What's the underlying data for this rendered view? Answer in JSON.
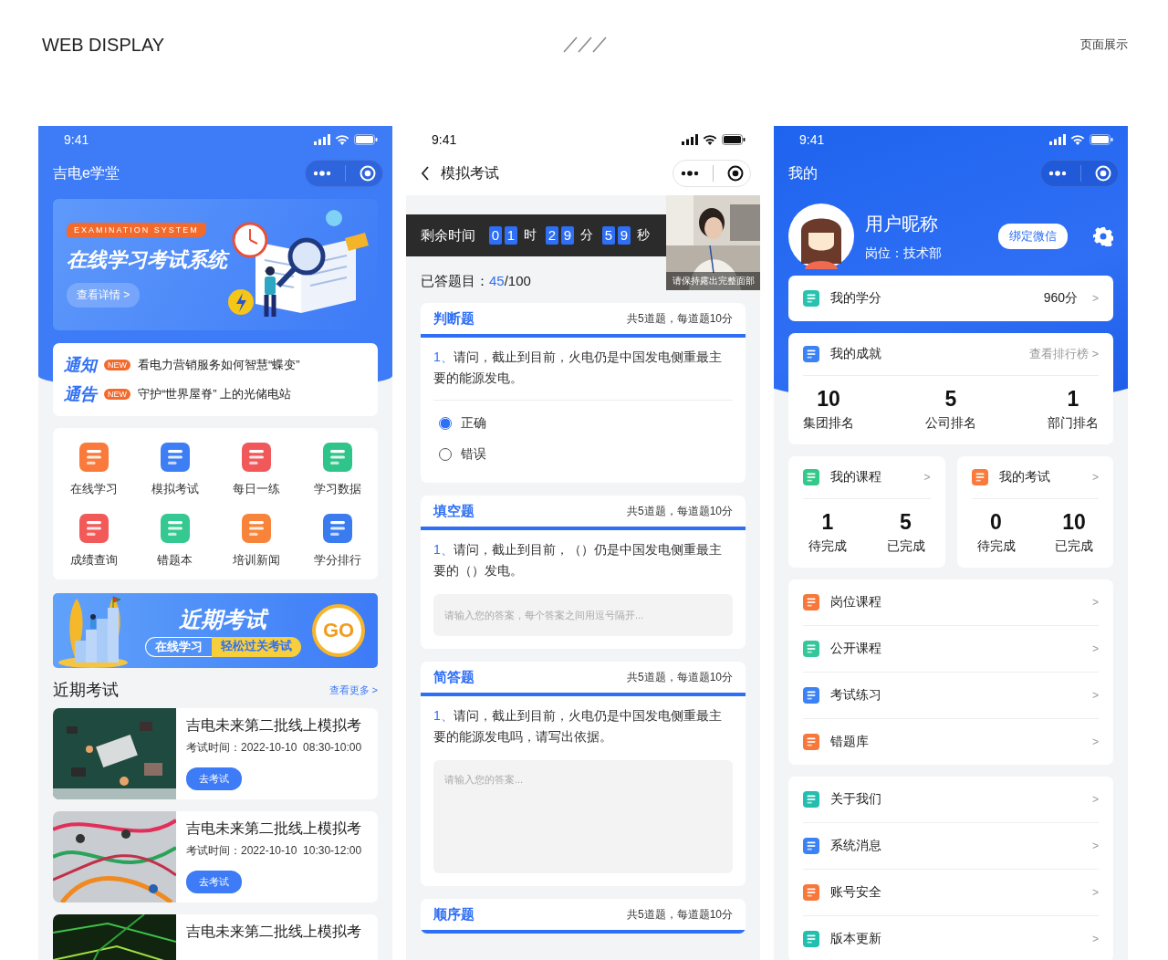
{
  "page": {
    "heading": "WEB DISPLAY",
    "subheading": "页面展示"
  },
  "home": {
    "status_time": "9:41",
    "title": "吉电e学堂",
    "banner": {
      "tag": "EXAMINATION SYSTEM",
      "title": "在线学习考试系统",
      "button": "查看详情 >"
    },
    "notices": [
      {
        "logo": "通**知**",
        "badge": "NEW",
        "text": "看电力营销服务如何智慧“蝶变”"
      },
      {
        "logo": "通**告**",
        "badge": "NEW",
        "text": "守护“世界屋脊” 上的光储电站"
      }
    ],
    "menu": [
      {
        "label": "在线学习",
        "color": "#f97a3a"
      },
      {
        "label": "模拟考试",
        "color": "#3d7ef5"
      },
      {
        "label": "每日一练",
        "color": "#f0585a"
      },
      {
        "label": "学习数据",
        "color": "#2fc48a"
      },
      {
        "label": "成绩查询",
        "color": "#f25a5a"
      },
      {
        "label": "错题本",
        "color": "#35c890"
      },
      {
        "label": "培训新闻",
        "color": "#f7843a"
      },
      {
        "label": "学分排行",
        "color": "#3a7cf0"
      }
    ],
    "promo": {
      "title": "近期考试",
      "tag_left": "在线学习",
      "tag_right": "轻松过关考试",
      "go": "GO"
    },
    "section": {
      "title": "近期考试",
      "more": "查看更多 >"
    },
    "exams": [
      {
        "title": "吉电未来第二批线上模拟考",
        "time": "考试时间：2022-10-10  08:30-10:00",
        "button": "去考试"
      },
      {
        "title": "吉电未来第二批线上模拟考",
        "time": "考试时间：2022-10-10  10:30-12:00",
        "button": "去考试"
      },
      {
        "title": "吉电未来第二批线上模拟考"
      }
    ]
  },
  "exam": {
    "status_time": "9:41",
    "title": "模拟考试",
    "timer": {
      "label": "剩余时间",
      "units": [
        {
          "digits": [
            "0",
            "1"
          ],
          "unit": "时"
        },
        {
          "digits": [
            "2",
            "9"
          ],
          "unit": "分"
        },
        {
          "digits": [
            "5",
            "9"
          ],
          "unit": "秒"
        }
      ]
    },
    "camera": {
      "caption": "请保持露出完整面部"
    },
    "answered": {
      "label": "已答题目：",
      "done": "45",
      "total": "/100"
    },
    "sections": [
      {
        "kind": "choice",
        "title": "判断题",
        "meta": "共5道题，每道题10分",
        "number": "1、",
        "question": "请问，截止到目前，火电仍是中国发电侧重最主要的能源发电。",
        "options": [
          {
            "label": "正确",
            "selected": true
          },
          {
            "label": "错误",
            "selected": false
          }
        ]
      },
      {
        "kind": "fill",
        "title": "填空题",
        "meta": "共5道题，每道题10分",
        "number": "1、",
        "question": "请问，截止到目前，（）仍是中国发电侧重最主要的（）发电。",
        "placeholder": "请输入您的答案，每个答案之间用逗号隔开..."
      },
      {
        "kind": "essay",
        "title": "简答题",
        "meta": "共5道题，每道题10分",
        "number": "1、",
        "question": "请问，截止到目前，火电仍是中国发电侧重最主要的能源发电吗，请写出依据。",
        "placeholder": "请输入您的答案..."
      },
      {
        "kind": "header",
        "title": "顺序题",
        "meta": "共5道题，每道题10分"
      }
    ]
  },
  "profile": {
    "status_time": "9:41",
    "title": "我的",
    "user": {
      "name": "用户昵称",
      "position": "岗位：技术部",
      "bind": "绑定微信"
    },
    "credits": {
      "label": "我的学分",
      "value": "960分",
      "arrow": ">",
      "color": "#28c3b0"
    },
    "achievements": {
      "label": "我的成就",
      "link": "查看排行榜 >",
      "color": "#3b82f6",
      "stats": [
        {
          "value": "10",
          "label": "集团排名"
        },
        {
          "value": "5",
          "label": "公司排名"
        },
        {
          "value": "1",
          "label": "部门排名"
        }
      ]
    },
    "summaries": [
      {
        "label": "我的课程",
        "arrow": ">",
        "color": "#34c98a",
        "stats": [
          {
            "value": "1",
            "label": "待完成"
          },
          {
            "value": "5",
            "label": "已完成"
          }
        ]
      },
      {
        "label": "我的考试",
        "arrow": ">",
        "color": "#f97a3a",
        "stats": [
          {
            "value": "0",
            "label": "待完成"
          },
          {
            "value": "10",
            "label": "已完成"
          }
        ]
      }
    ],
    "menus": [
      [
        {
          "label": "岗位课程",
          "arrow": ">",
          "color": "#f8773a"
        },
        {
          "label": "公开课程",
          "arrow": ">",
          "color": "#33c79a"
        },
        {
          "label": "考试练习",
          "arrow": ">",
          "color": "#3b82f6"
        },
        {
          "label": "错题库",
          "arrow": ">",
          "color": "#f8773a"
        }
      ],
      [
        {
          "label": "关于我们",
          "arrow": ">",
          "color": "#22bfae"
        },
        {
          "label": "系统消息",
          "arrow": ">",
          "color": "#3b82f6"
        },
        {
          "label": "账号安全",
          "arrow": ">",
          "color": "#f8773a"
        },
        {
          "label": "版本更新",
          "arrow": ">",
          "color": "#22bfae"
        }
      ]
    ]
  }
}
